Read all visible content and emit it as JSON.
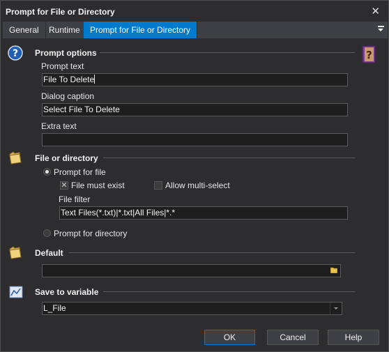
{
  "window": {
    "title": "Prompt for File or Directory"
  },
  "tabs": [
    {
      "label": "General"
    },
    {
      "label": "Runtime"
    },
    {
      "label": "Prompt for File or Directory"
    }
  ],
  "prompt_options": {
    "title": "Prompt options",
    "prompt_text_label": "Prompt text",
    "prompt_text_value": "File To Delete",
    "dialog_caption_label": "Dialog caption",
    "dialog_caption_value": "Select File To Delete",
    "extra_text_label": "Extra text",
    "extra_text_value": ""
  },
  "file_or_directory": {
    "title": "File or directory",
    "prompt_for_file_label": "Prompt for file",
    "file_must_exist_label": "File must exist",
    "allow_multi_select_label": "Allow multi-select",
    "file_filter_label": "File filter",
    "file_filter_value": "Text Files(*.txt)|*.txt|All Files|*.*",
    "prompt_for_directory_label": "Prompt for directory",
    "selected": "file",
    "file_must_exist_checked": true,
    "allow_multi_select_checked": false
  },
  "default": {
    "title": "Default",
    "value": ""
  },
  "save_to_variable": {
    "title": "Save to variable",
    "value": "L_File"
  },
  "buttons": {
    "ok": "OK",
    "cancel": "Cancel",
    "help": "Help"
  },
  "colors": {
    "accent": "#007acc",
    "background": "#2d2d30",
    "input": "#1e1e1e"
  },
  "icons": [
    "close-icon",
    "tab-menu-icon",
    "help-icon",
    "help-book-icon",
    "folder-icon",
    "folder-browse-icon",
    "chart-icon"
  ]
}
